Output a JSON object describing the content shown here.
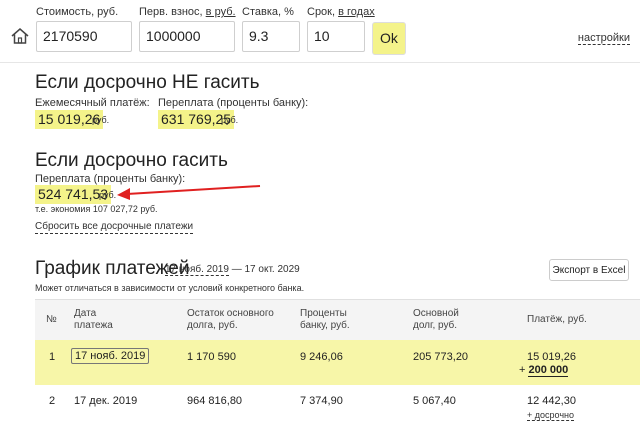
{
  "toolbar": {
    "cost_label": "Стоимость, руб.",
    "cost_value": "2170590",
    "down_label_prefix": "Перв. взнос, ",
    "down_label_unit": "в руб.",
    "down_value": "1000000",
    "rate_label": "Ставка, %",
    "rate_value": "9.3",
    "term_label_prefix": "Срок, ",
    "term_label_unit": "в годах",
    "term_value": "10",
    "ok_label": "Ok",
    "settings_label": "настройки"
  },
  "no_early": {
    "title": "Если досрочно НЕ гасить",
    "monthly_label": "Ежемесячный платёж:",
    "monthly_value": "15 019,26",
    "monthly_unit": "руб.",
    "overpay_label": "Переплата (проценты банку):",
    "overpay_value": "631 769,25",
    "overpay_unit": "руб."
  },
  "early": {
    "title": "Если досрочно гасить",
    "overpay_label": "Переплата (проценты банку):",
    "overpay_value": "524 741,53",
    "overpay_unit": "руб.",
    "savings": "т.е. экономия 107 027,72 руб.",
    "reset_label": "Сбросить все досрочные платежи"
  },
  "schedule": {
    "title": "График платежей",
    "date_from": "17 нояб. 2019",
    "date_sep": " — ",
    "date_to": "17 окт. 2029",
    "export_label": "Экспорт в Excel",
    "note": "Может отличаться в зависимости от условий конкретного банка.",
    "headers": {
      "num": "№",
      "date_1": "Дата",
      "date_2": "платежа",
      "rest_1": "Остаток основного",
      "rest_2": "долга, руб.",
      "interest_1": "Проценты",
      "interest_2": "банку, руб.",
      "principal_1": "Основной",
      "principal_2": "долг, руб.",
      "payment": "Платёж, руб."
    },
    "rows": [
      {
        "num": "1",
        "date": "17 нояб. 2019",
        "rest": "1 170 590",
        "interest": "9 246,06",
        "principal": "205 773,20",
        "payment": "15 019,26",
        "extra_prefix": "+ ",
        "extra": "200 000"
      },
      {
        "num": "2",
        "date": "17 дек. 2019",
        "rest": "964 816,80",
        "interest": "7 374,90",
        "principal": "5 067,40",
        "payment": "12 442,30",
        "extra_link": "+ досрочно"
      }
    ]
  },
  "colors": {
    "highlight": "#f4f38a",
    "row_highlight": "#f7f6a8",
    "arrow": "#e02020"
  },
  "icons": {
    "home": "home-icon",
    "arrow": "annotation-arrow-icon"
  }
}
